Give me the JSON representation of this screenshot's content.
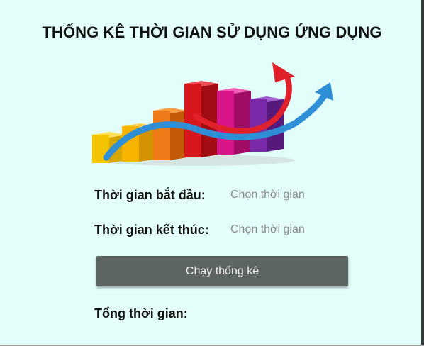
{
  "header": {
    "title": "THỐNG KÊ THỜI GIAN SỬ DỤNG ỨNG DỤNG"
  },
  "illustration": {
    "icon": "bar-chart-growth-illustration",
    "bar_colors": [
      "#f5c400",
      "#f6b400",
      "#ee7a18",
      "#d8161e",
      "#d8168a",
      "#7a2aa8"
    ],
    "arrow_colors": [
      "#e0202a",
      "#2e8fd6"
    ]
  },
  "form": {
    "start_label": "Thời gian bắt đầu:",
    "start_value": "Chọn thời gian",
    "end_label": "Thời gian kết thúc:",
    "end_value": "Chọn thời gian",
    "run_button_label": "Chạy thống kê",
    "total_label": "Tổng thời gian:"
  }
}
